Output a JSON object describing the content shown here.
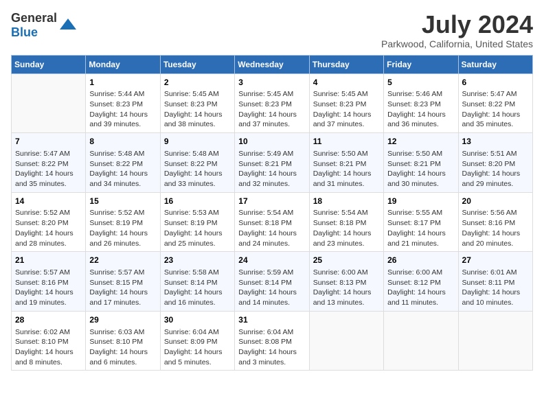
{
  "header": {
    "logo": {
      "text_general": "General",
      "text_blue": "Blue"
    },
    "title": "July 2024",
    "subtitle": "Parkwood, California, United States"
  },
  "calendar": {
    "days_of_week": [
      "Sunday",
      "Monday",
      "Tuesday",
      "Wednesday",
      "Thursday",
      "Friday",
      "Saturday"
    ],
    "weeks": [
      [
        {
          "day": "",
          "content": ""
        },
        {
          "day": "1",
          "content": "Sunrise: 5:44 AM\nSunset: 8:23 PM\nDaylight: 14 hours\nand 39 minutes."
        },
        {
          "day": "2",
          "content": "Sunrise: 5:45 AM\nSunset: 8:23 PM\nDaylight: 14 hours\nand 38 minutes."
        },
        {
          "day": "3",
          "content": "Sunrise: 5:45 AM\nSunset: 8:23 PM\nDaylight: 14 hours\nand 37 minutes."
        },
        {
          "day": "4",
          "content": "Sunrise: 5:45 AM\nSunset: 8:23 PM\nDaylight: 14 hours\nand 37 minutes."
        },
        {
          "day": "5",
          "content": "Sunrise: 5:46 AM\nSunset: 8:23 PM\nDaylight: 14 hours\nand 36 minutes."
        },
        {
          "day": "6",
          "content": "Sunrise: 5:47 AM\nSunset: 8:22 PM\nDaylight: 14 hours\nand 35 minutes."
        }
      ],
      [
        {
          "day": "7",
          "content": "Sunrise: 5:47 AM\nSunset: 8:22 PM\nDaylight: 14 hours\nand 35 minutes."
        },
        {
          "day": "8",
          "content": "Sunrise: 5:48 AM\nSunset: 8:22 PM\nDaylight: 14 hours\nand 34 minutes."
        },
        {
          "day": "9",
          "content": "Sunrise: 5:48 AM\nSunset: 8:22 PM\nDaylight: 14 hours\nand 33 minutes."
        },
        {
          "day": "10",
          "content": "Sunrise: 5:49 AM\nSunset: 8:21 PM\nDaylight: 14 hours\nand 32 minutes."
        },
        {
          "day": "11",
          "content": "Sunrise: 5:50 AM\nSunset: 8:21 PM\nDaylight: 14 hours\nand 31 minutes."
        },
        {
          "day": "12",
          "content": "Sunrise: 5:50 AM\nSunset: 8:21 PM\nDaylight: 14 hours\nand 30 minutes."
        },
        {
          "day": "13",
          "content": "Sunrise: 5:51 AM\nSunset: 8:20 PM\nDaylight: 14 hours\nand 29 minutes."
        }
      ],
      [
        {
          "day": "14",
          "content": "Sunrise: 5:52 AM\nSunset: 8:20 PM\nDaylight: 14 hours\nand 28 minutes."
        },
        {
          "day": "15",
          "content": "Sunrise: 5:52 AM\nSunset: 8:19 PM\nDaylight: 14 hours\nand 26 minutes."
        },
        {
          "day": "16",
          "content": "Sunrise: 5:53 AM\nSunset: 8:19 PM\nDaylight: 14 hours\nand 25 minutes."
        },
        {
          "day": "17",
          "content": "Sunrise: 5:54 AM\nSunset: 8:18 PM\nDaylight: 14 hours\nand 24 minutes."
        },
        {
          "day": "18",
          "content": "Sunrise: 5:54 AM\nSunset: 8:18 PM\nDaylight: 14 hours\nand 23 minutes."
        },
        {
          "day": "19",
          "content": "Sunrise: 5:55 AM\nSunset: 8:17 PM\nDaylight: 14 hours\nand 21 minutes."
        },
        {
          "day": "20",
          "content": "Sunrise: 5:56 AM\nSunset: 8:16 PM\nDaylight: 14 hours\nand 20 minutes."
        }
      ],
      [
        {
          "day": "21",
          "content": "Sunrise: 5:57 AM\nSunset: 8:16 PM\nDaylight: 14 hours\nand 19 minutes."
        },
        {
          "day": "22",
          "content": "Sunrise: 5:57 AM\nSunset: 8:15 PM\nDaylight: 14 hours\nand 17 minutes."
        },
        {
          "day": "23",
          "content": "Sunrise: 5:58 AM\nSunset: 8:14 PM\nDaylight: 14 hours\nand 16 minutes."
        },
        {
          "day": "24",
          "content": "Sunrise: 5:59 AM\nSunset: 8:14 PM\nDaylight: 14 hours\nand 14 minutes."
        },
        {
          "day": "25",
          "content": "Sunrise: 6:00 AM\nSunset: 8:13 PM\nDaylight: 14 hours\nand 13 minutes."
        },
        {
          "day": "26",
          "content": "Sunrise: 6:00 AM\nSunset: 8:12 PM\nDaylight: 14 hours\nand 11 minutes."
        },
        {
          "day": "27",
          "content": "Sunrise: 6:01 AM\nSunset: 8:11 PM\nDaylight: 14 hours\nand 10 minutes."
        }
      ],
      [
        {
          "day": "28",
          "content": "Sunrise: 6:02 AM\nSunset: 8:10 PM\nDaylight: 14 hours\nand 8 minutes."
        },
        {
          "day": "29",
          "content": "Sunrise: 6:03 AM\nSunset: 8:10 PM\nDaylight: 14 hours\nand 6 minutes."
        },
        {
          "day": "30",
          "content": "Sunrise: 6:04 AM\nSunset: 8:09 PM\nDaylight: 14 hours\nand 5 minutes."
        },
        {
          "day": "31",
          "content": "Sunrise: 6:04 AM\nSunset: 8:08 PM\nDaylight: 14 hours\nand 3 minutes."
        },
        {
          "day": "",
          "content": ""
        },
        {
          "day": "",
          "content": ""
        },
        {
          "day": "",
          "content": ""
        }
      ]
    ]
  }
}
